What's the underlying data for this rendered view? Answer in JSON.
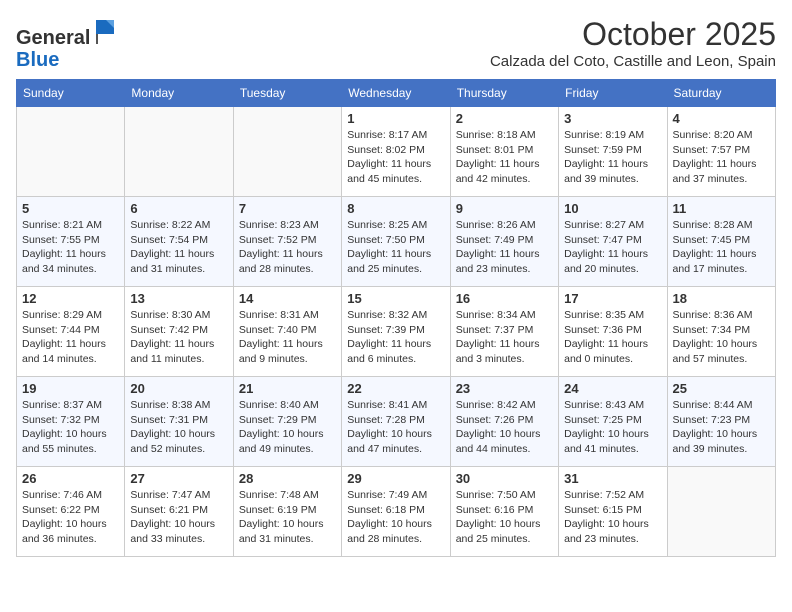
{
  "header": {
    "logo_general": "General",
    "logo_blue": "Blue",
    "month_title": "October 2025",
    "subtitle": "Calzada del Coto, Castille and Leon, Spain"
  },
  "days_of_week": [
    "Sunday",
    "Monday",
    "Tuesday",
    "Wednesday",
    "Thursday",
    "Friday",
    "Saturday"
  ],
  "weeks": [
    [
      {
        "day": "",
        "info": ""
      },
      {
        "day": "",
        "info": ""
      },
      {
        "day": "",
        "info": ""
      },
      {
        "day": "1",
        "info": "Sunrise: 8:17 AM\nSunset: 8:02 PM\nDaylight: 11 hours and 45 minutes."
      },
      {
        "day": "2",
        "info": "Sunrise: 8:18 AM\nSunset: 8:01 PM\nDaylight: 11 hours and 42 minutes."
      },
      {
        "day": "3",
        "info": "Sunrise: 8:19 AM\nSunset: 7:59 PM\nDaylight: 11 hours and 39 minutes."
      },
      {
        "day": "4",
        "info": "Sunrise: 8:20 AM\nSunset: 7:57 PM\nDaylight: 11 hours and 37 minutes."
      }
    ],
    [
      {
        "day": "5",
        "info": "Sunrise: 8:21 AM\nSunset: 7:55 PM\nDaylight: 11 hours and 34 minutes."
      },
      {
        "day": "6",
        "info": "Sunrise: 8:22 AM\nSunset: 7:54 PM\nDaylight: 11 hours and 31 minutes."
      },
      {
        "day": "7",
        "info": "Sunrise: 8:23 AM\nSunset: 7:52 PM\nDaylight: 11 hours and 28 minutes."
      },
      {
        "day": "8",
        "info": "Sunrise: 8:25 AM\nSunset: 7:50 PM\nDaylight: 11 hours and 25 minutes."
      },
      {
        "day": "9",
        "info": "Sunrise: 8:26 AM\nSunset: 7:49 PM\nDaylight: 11 hours and 23 minutes."
      },
      {
        "day": "10",
        "info": "Sunrise: 8:27 AM\nSunset: 7:47 PM\nDaylight: 11 hours and 20 minutes."
      },
      {
        "day": "11",
        "info": "Sunrise: 8:28 AM\nSunset: 7:45 PM\nDaylight: 11 hours and 17 minutes."
      }
    ],
    [
      {
        "day": "12",
        "info": "Sunrise: 8:29 AM\nSunset: 7:44 PM\nDaylight: 11 hours and 14 minutes."
      },
      {
        "day": "13",
        "info": "Sunrise: 8:30 AM\nSunset: 7:42 PM\nDaylight: 11 hours and 11 minutes."
      },
      {
        "day": "14",
        "info": "Sunrise: 8:31 AM\nSunset: 7:40 PM\nDaylight: 11 hours and 9 minutes."
      },
      {
        "day": "15",
        "info": "Sunrise: 8:32 AM\nSunset: 7:39 PM\nDaylight: 11 hours and 6 minutes."
      },
      {
        "day": "16",
        "info": "Sunrise: 8:34 AM\nSunset: 7:37 PM\nDaylight: 11 hours and 3 minutes."
      },
      {
        "day": "17",
        "info": "Sunrise: 8:35 AM\nSunset: 7:36 PM\nDaylight: 11 hours and 0 minutes."
      },
      {
        "day": "18",
        "info": "Sunrise: 8:36 AM\nSunset: 7:34 PM\nDaylight: 10 hours and 57 minutes."
      }
    ],
    [
      {
        "day": "19",
        "info": "Sunrise: 8:37 AM\nSunset: 7:32 PM\nDaylight: 10 hours and 55 minutes."
      },
      {
        "day": "20",
        "info": "Sunrise: 8:38 AM\nSunset: 7:31 PM\nDaylight: 10 hours and 52 minutes."
      },
      {
        "day": "21",
        "info": "Sunrise: 8:40 AM\nSunset: 7:29 PM\nDaylight: 10 hours and 49 minutes."
      },
      {
        "day": "22",
        "info": "Sunrise: 8:41 AM\nSunset: 7:28 PM\nDaylight: 10 hours and 47 minutes."
      },
      {
        "day": "23",
        "info": "Sunrise: 8:42 AM\nSunset: 7:26 PM\nDaylight: 10 hours and 44 minutes."
      },
      {
        "day": "24",
        "info": "Sunrise: 8:43 AM\nSunset: 7:25 PM\nDaylight: 10 hours and 41 minutes."
      },
      {
        "day": "25",
        "info": "Sunrise: 8:44 AM\nSunset: 7:23 PM\nDaylight: 10 hours and 39 minutes."
      }
    ],
    [
      {
        "day": "26",
        "info": "Sunrise: 7:46 AM\nSunset: 6:22 PM\nDaylight: 10 hours and 36 minutes."
      },
      {
        "day": "27",
        "info": "Sunrise: 7:47 AM\nSunset: 6:21 PM\nDaylight: 10 hours and 33 minutes."
      },
      {
        "day": "28",
        "info": "Sunrise: 7:48 AM\nSunset: 6:19 PM\nDaylight: 10 hours and 31 minutes."
      },
      {
        "day": "29",
        "info": "Sunrise: 7:49 AM\nSunset: 6:18 PM\nDaylight: 10 hours and 28 minutes."
      },
      {
        "day": "30",
        "info": "Sunrise: 7:50 AM\nSunset: 6:16 PM\nDaylight: 10 hours and 25 minutes."
      },
      {
        "day": "31",
        "info": "Sunrise: 7:52 AM\nSunset: 6:15 PM\nDaylight: 10 hours and 23 minutes."
      },
      {
        "day": "",
        "info": ""
      }
    ]
  ]
}
